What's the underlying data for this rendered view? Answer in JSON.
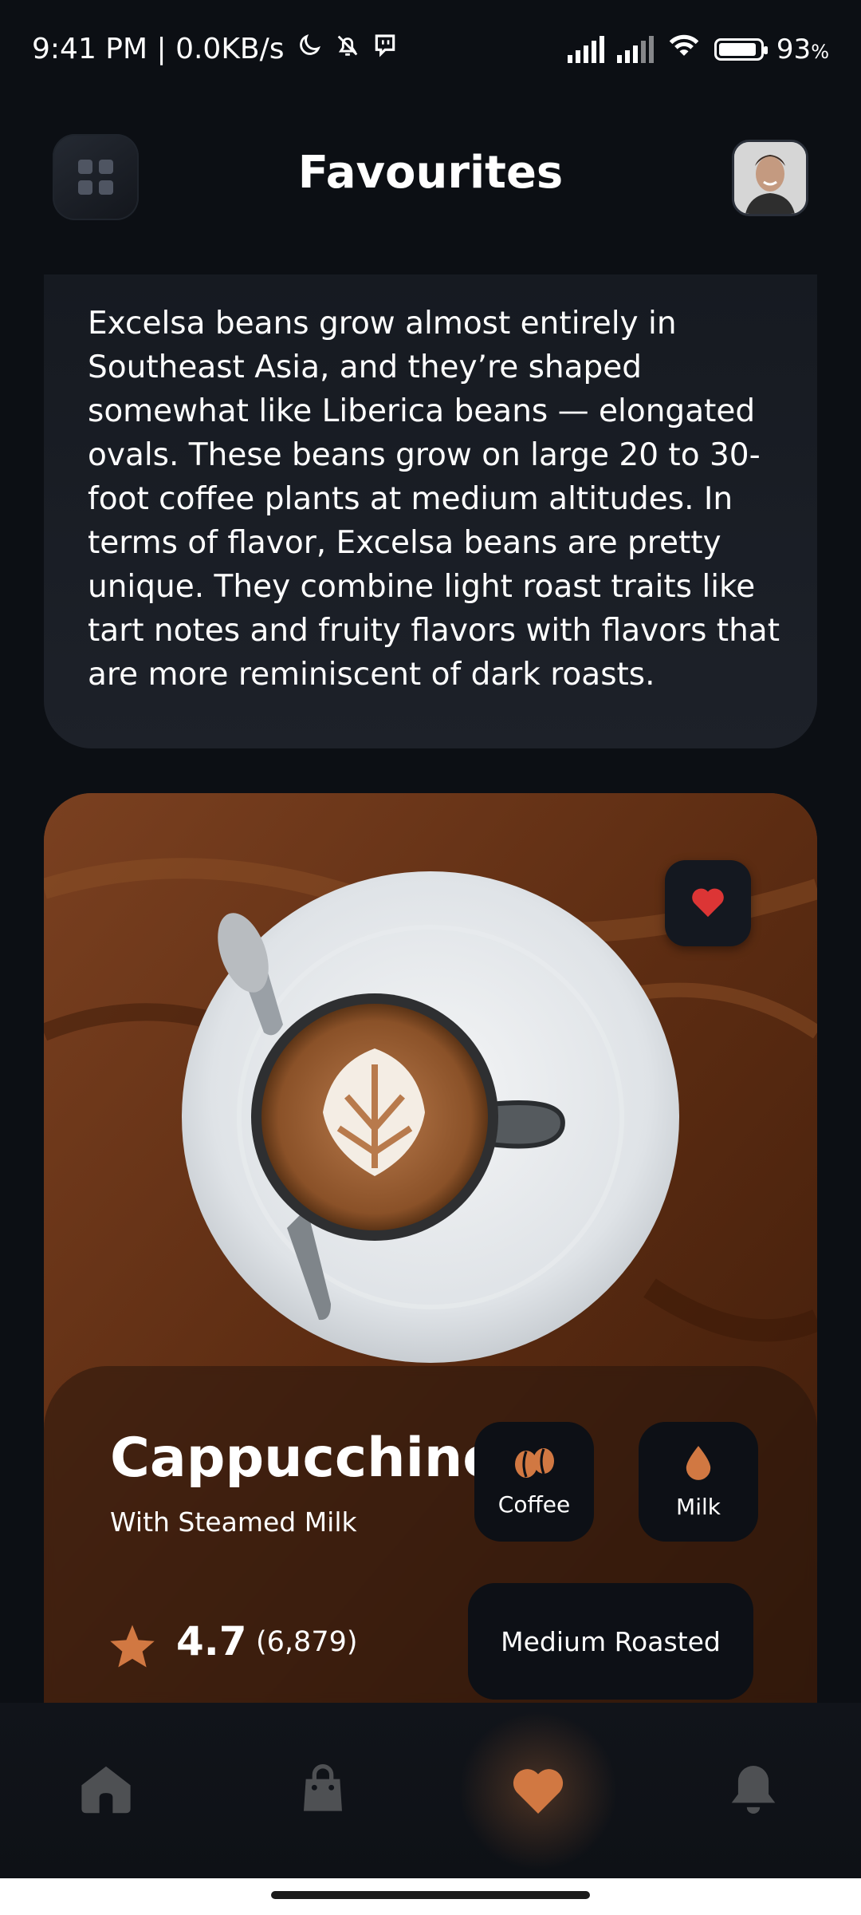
{
  "status_bar": {
    "time_speed": "9:41 PM | 0.0KB/s",
    "battery": "93",
    "battery_unit": "%",
    "battery_level": 0.93,
    "icons": [
      "moon-icon",
      "bell-off-icon",
      "chat-icon",
      "signal-icon",
      "signal-icon",
      "wifi-icon",
      "battery-icon"
    ]
  },
  "header": {
    "title": "Favourites",
    "menu_icon": "grid-icon",
    "avatar": "user-avatar"
  },
  "description": {
    "text": "Excelsa beans grow almost entirely in Southeast Asia, and they’re shaped somewhat like Liberica beans — elongated ovals. These beans grow on large 20 to 30-foot coffee plants at medium altitudes. In terms of flavor, Excelsa beans are pretty unique. They combine light roast traits like tart notes and fruity flavors with flavors that are more reminiscent of dark roasts."
  },
  "product": {
    "name": "Cappucchino",
    "subtitle": "With Steamed Milk",
    "rating": "4.7",
    "rating_count": "(6,879)",
    "favorite": true,
    "ingredients": [
      {
        "label": "Coffee",
        "icon": "coffee-beans-icon"
      },
      {
        "label": "Milk",
        "icon": "milk-drop-icon"
      }
    ],
    "roast": "Medium Roasted"
  },
  "colors": {
    "accent": "#D17842",
    "heart_red": "#DC3535",
    "background": "#0C0F14",
    "icon_inactive": "#4E5053"
  },
  "bottom_nav": {
    "items": [
      "home-icon",
      "bag-icon",
      "heart-icon",
      "bell-icon"
    ],
    "active": "heart-icon"
  }
}
